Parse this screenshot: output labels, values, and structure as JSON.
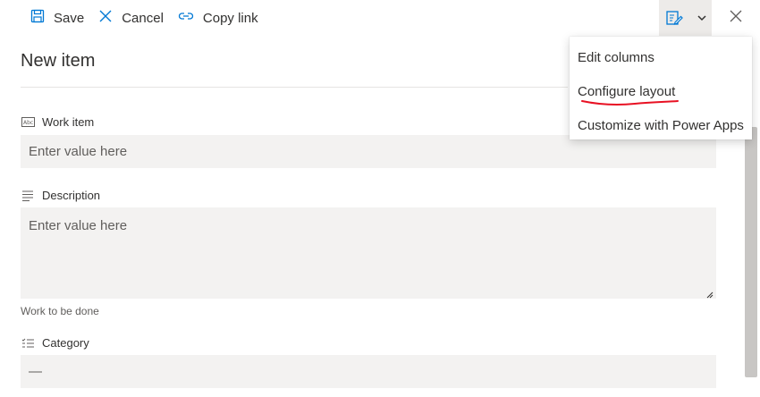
{
  "toolbar": {
    "save_label": "Save",
    "cancel_label": "Cancel",
    "copy_link_label": "Copy link"
  },
  "panel": {
    "title": "New item"
  },
  "fields": {
    "work_item": {
      "label": "Work item",
      "placeholder": "Enter value here"
    },
    "description": {
      "label": "Description",
      "placeholder": "Enter value here",
      "helper": "Work to be done"
    },
    "category": {
      "label": "Category",
      "value": "—"
    }
  },
  "menu": {
    "items": [
      {
        "label": "Edit columns"
      },
      {
        "label": "Configure layout"
      },
      {
        "label": "Customize with Power Apps"
      }
    ]
  },
  "icons": {
    "save": "save-icon",
    "cancel": "cancel-icon",
    "copy_link": "link-icon",
    "form_view": "form-edit-icon",
    "chevron": "chevron-down-icon",
    "close": "close-icon",
    "text_field": "text-field-icon",
    "multiline_field": "multiline-text-icon",
    "choice_field": "choice-list-icon"
  },
  "colors": {
    "accent": "#0078d4",
    "annotation": "#e81123",
    "input_bg": "#f3f2f1"
  }
}
